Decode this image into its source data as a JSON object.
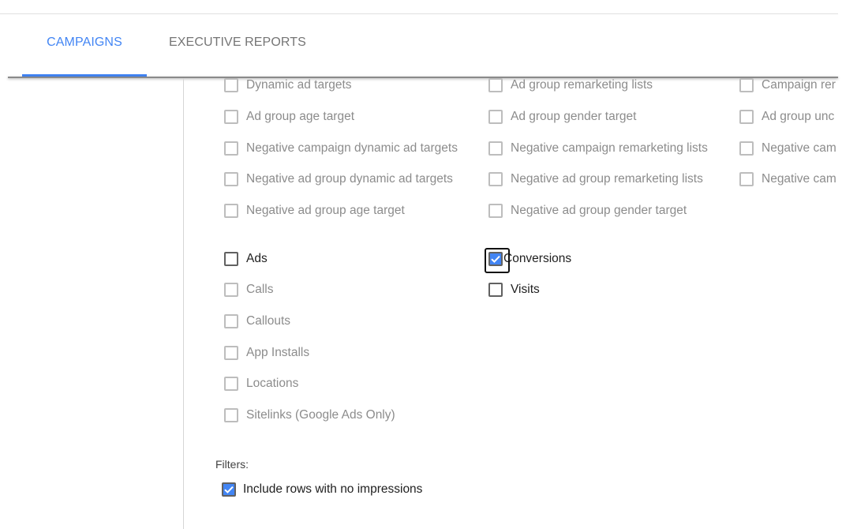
{
  "tabs": [
    {
      "label": "CAMPAIGNS",
      "active": true
    },
    {
      "label": "EXECUTIVE REPORTS",
      "active": false
    }
  ],
  "columns": [
    {
      "items": [
        {
          "label": "Dynamic ad targets",
          "checked": false,
          "disabled": true
        },
        {
          "label": "Ad group age target",
          "checked": false,
          "disabled": true
        },
        {
          "label": "Negative campaign dynamic ad targets",
          "checked": false,
          "disabled": true
        },
        {
          "label": "Negative ad group dynamic ad targets",
          "checked": false,
          "disabled": true
        },
        {
          "label": "Negative ad group age target",
          "checked": false,
          "disabled": true
        }
      ]
    },
    {
      "items": [
        {
          "label": "Ad group remarketing lists",
          "checked": false,
          "disabled": true
        },
        {
          "label": "Ad group gender target",
          "checked": false,
          "disabled": true
        },
        {
          "label": "Negative campaign remarketing lists",
          "checked": false,
          "disabled": true
        },
        {
          "label": "Negative ad group remarketing lists",
          "checked": false,
          "disabled": true
        },
        {
          "label": "Negative ad group gender target",
          "checked": false,
          "disabled": true
        }
      ]
    },
    {
      "items": [
        {
          "label": "Campaign rer",
          "checked": false,
          "disabled": true
        },
        {
          "label": "Ad group unc",
          "checked": false,
          "disabled": true
        },
        {
          "label": "Negative cam",
          "checked": false,
          "disabled": true
        },
        {
          "label": "Negative cam",
          "checked": false,
          "disabled": true
        }
      ]
    }
  ],
  "report_types_left": [
    {
      "label": "Ads",
      "checked": false,
      "disabled": false
    },
    {
      "label": "Calls",
      "checked": false,
      "disabled": true
    },
    {
      "label": "Callouts",
      "checked": false,
      "disabled": true
    },
    {
      "label": "App Installs",
      "checked": false,
      "disabled": true
    },
    {
      "label": "Locations",
      "checked": false,
      "disabled": true
    },
    {
      "label": "Sitelinks (Google Ads Only)",
      "checked": false,
      "disabled": true
    }
  ],
  "report_types_right": [
    {
      "label": "Conversions",
      "checked": true,
      "disabled": false,
      "focused": true
    },
    {
      "label": "Visits",
      "checked": false,
      "disabled": false
    }
  ],
  "filters": {
    "label": "Filters:",
    "option": {
      "label": "Include rows with no impressions",
      "checked": true
    }
  },
  "colors": {
    "accent": "#4285f4",
    "inactive_tab": "#757575",
    "disabled_text": "#8c8c8c"
  }
}
